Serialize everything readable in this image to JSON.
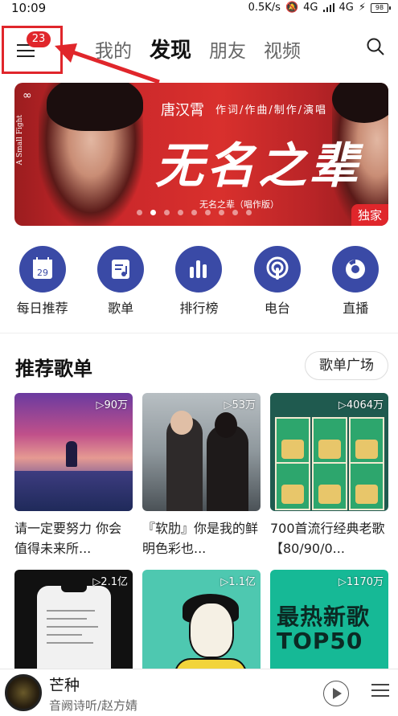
{
  "status": {
    "time": "10:09",
    "net": "0.5K/s",
    "net1": "4G",
    "net2": "4G",
    "battery": "98"
  },
  "nav": {
    "badge": "23",
    "tabs": [
      "我的",
      "发现",
      "朋友",
      "视频"
    ],
    "active_tab": "发现"
  },
  "banner": {
    "side_text": "A Small Fight",
    "artist": "唐汉霄",
    "role": "作词/作曲/制作/演唱",
    "big_title": "无名之辈",
    "subtitle": "无名之辈（唱作版）",
    "tag": "独家",
    "dots_count": 9,
    "active_dot": 1
  },
  "shortcuts": [
    {
      "label": "每日推荐",
      "icon": "calendar-icon",
      "num": "29"
    },
    {
      "label": "歌单",
      "icon": "playlist-icon"
    },
    {
      "label": "排行榜",
      "icon": "chart-icon"
    },
    {
      "label": "电台",
      "icon": "radio-icon"
    },
    {
      "label": "直播",
      "icon": "live-icon"
    }
  ],
  "section": {
    "title": "推荐歌单",
    "button": "歌单广场"
  },
  "playlists": [
    {
      "plays": "▷90万",
      "title": "请一定要努力 你会值得未来所..."
    },
    {
      "plays": "▷53万",
      "title": "『软肋』你是我的鲜明色彩也..."
    },
    {
      "plays": "▷4064万",
      "title": "700首流行经典老歌【80/90/0..."
    },
    {
      "plays": "▷2.1亿",
      "title": ""
    },
    {
      "plays": "▷1.1亿",
      "title": ""
    },
    {
      "plays": "▷1170万",
      "title": ""
    }
  ],
  "cover6_text": "最热新歌TOP50",
  "player": {
    "song": "芒种",
    "artist": "音阙诗听/赵方婧"
  },
  "colors": {
    "accent": "#e0262b",
    "icon_bg": "#3a4aa6"
  }
}
